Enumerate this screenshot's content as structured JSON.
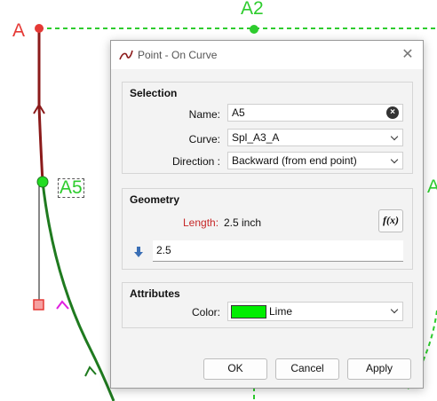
{
  "canvas": {
    "labels": {
      "a": "A",
      "a2": "A2",
      "a5": "A5",
      "a_right": "A"
    }
  },
  "dialog": {
    "title": "Point - On Curve",
    "selection": {
      "title": "Selection",
      "name_label": "Name:",
      "name_value": "A5",
      "curve_label": "Curve:",
      "curve_value": "Spl_A3_A",
      "direction_label": "Direction :",
      "direction_value": "Backward (from end point)"
    },
    "geometry": {
      "title": "Geometry",
      "length_label": "Length:",
      "length_value": "2.5 inch",
      "expression_value": "2.5",
      "function_button": "f(x)"
    },
    "attributes": {
      "title": "Attributes",
      "color_label": "Color:",
      "color_value": "Lime",
      "color_hex": "#00ee00"
    },
    "buttons": {
      "ok": "OK",
      "cancel": "Cancel",
      "apply": "Apply"
    }
  },
  "colors": {
    "accent_red": "#e53935",
    "curve_dark_red": "#8b1a1a",
    "curve_green": "#1f7a1f",
    "dashed_green": "#2ecc2e",
    "length_red": "#c62828"
  }
}
